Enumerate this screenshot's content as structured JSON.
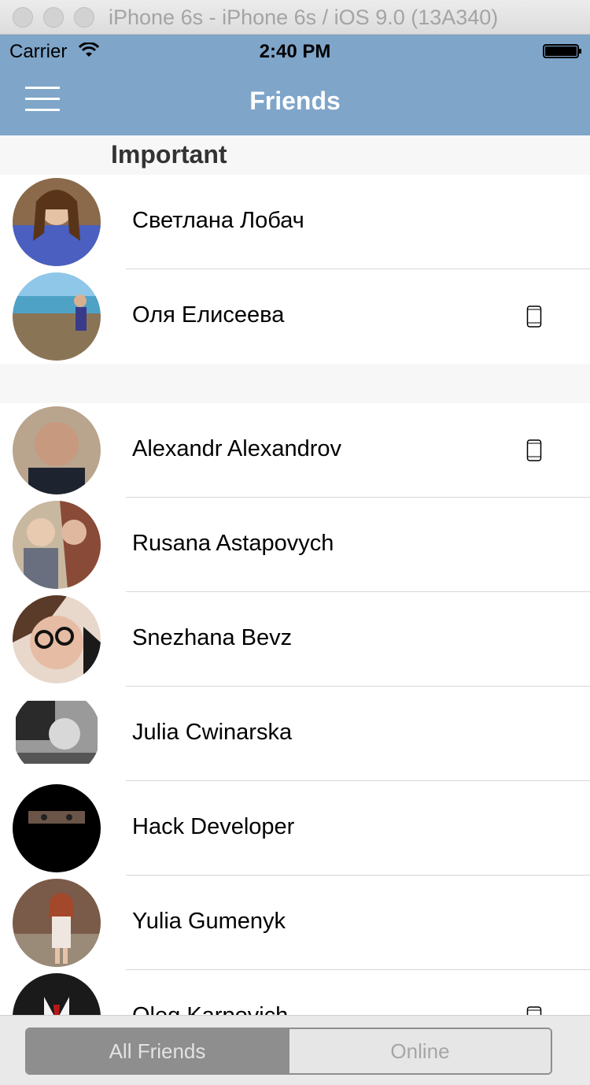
{
  "simulator": {
    "title": "iPhone 6s - iPhone 6s / iOS 9.0 (13A340)"
  },
  "status_bar": {
    "carrier": "Carrier",
    "time": "2:40 PM"
  },
  "navbar": {
    "title": "Friends"
  },
  "sections": {
    "important": {
      "header": "Important",
      "friends": [
        {
          "name": "Светлана Лобач",
          "mobile": false
        },
        {
          "name": "Оля Елисеева",
          "mobile": true
        }
      ]
    },
    "all": {
      "friends": [
        {
          "name": "Alexandr Alexandrov",
          "mobile": true
        },
        {
          "name": "Rusana Astapovych",
          "mobile": false
        },
        {
          "name": "Snezhana Bevz",
          "mobile": false
        },
        {
          "name": "Julia Cwinarska",
          "mobile": false
        },
        {
          "name": "Hack Developer",
          "mobile": false
        },
        {
          "name": "Yulia Gumenyk",
          "mobile": false
        },
        {
          "name": "Oleg Karpovich",
          "mobile": true
        }
      ]
    }
  },
  "segmented_control": {
    "options": [
      "All Friends",
      "Online"
    ],
    "selected": "All Friends"
  },
  "colors": {
    "navbar": "#7fa5c9",
    "segment_active": "#8e8e8e"
  }
}
